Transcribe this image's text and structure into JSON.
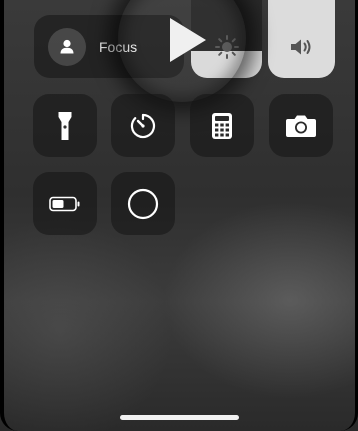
{
  "control_center": {
    "focus": {
      "label": "Focus",
      "icon": "person-icon"
    },
    "brightness": {
      "icon": "sun-icon",
      "level": 0.35
    },
    "volume": {
      "icon": "speaker-icon",
      "level": 1.0
    },
    "magnifier": {
      "icon": "play-icon"
    },
    "tiles": [
      {
        "name": "flashlight-button",
        "icon": "flashlight-icon"
      },
      {
        "name": "timer-button",
        "icon": "timer-icon"
      },
      {
        "name": "calculator-button",
        "icon": "calculator-icon"
      },
      {
        "name": "camera-button",
        "icon": "camera-icon"
      },
      {
        "name": "low-power-mode-button",
        "icon": "battery-icon"
      },
      {
        "name": "screen-record-button",
        "icon": "record-icon"
      }
    ]
  }
}
